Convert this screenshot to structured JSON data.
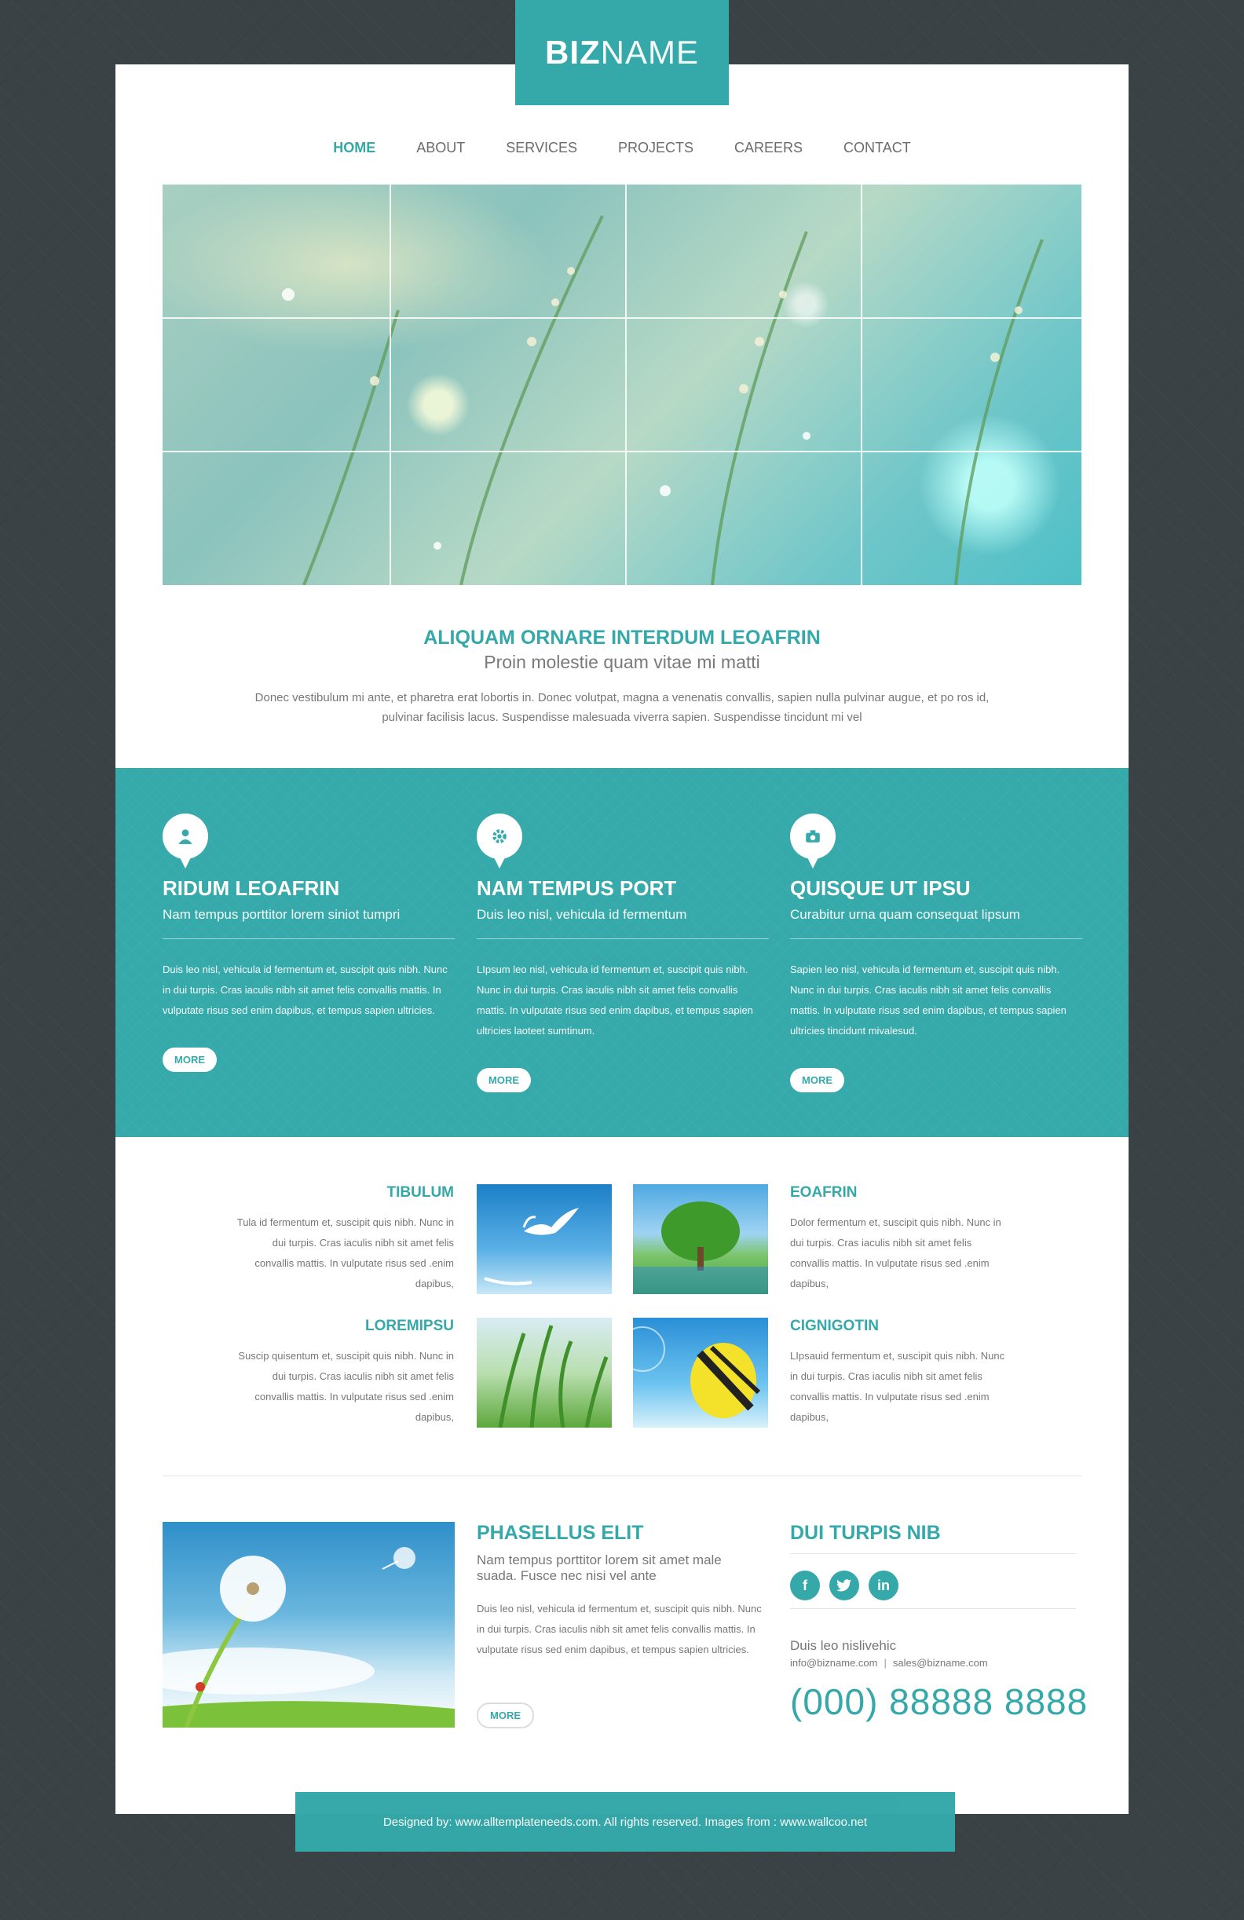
{
  "brand": {
    "bold": "BIZ",
    "light": "NAME"
  },
  "nav": [
    {
      "label": "HOME",
      "active": true
    },
    {
      "label": "ABOUT"
    },
    {
      "label": "SERVICES"
    },
    {
      "label": "PROJECTS"
    },
    {
      "label": "CAREERS"
    },
    {
      "label": "CONTACT"
    }
  ],
  "intro": {
    "title": "ALIQUAM ORNARE INTERDUM LEOAFRIN",
    "subtitle": "Proin molestie quam vitae mi matti",
    "text": "Donec vestibulum mi ante, et pharetra erat lobortis in. Donec volutpat, magna a venenatis convallis, sapien nulla pulvinar augue, et po ros id, pulvinar facilisis lacus. Suspendisse malesuada viverra sapien. Suspendisse tincidunt mi vel"
  },
  "features": [
    {
      "icon": "user-icon",
      "title": "RIDUM LEOAFRIN",
      "subtitle": "Nam tempus porttitor lorem siniot tumpri",
      "text": "Duis leo nisl, vehicula id fermentum et, suscipit quis nibh. Nunc in dui turpis. Cras iaculis nibh sit amet felis convallis mattis. In vulputate risus sed enim dapibus, et tempus sapien ultricies.",
      "more": "MORE"
    },
    {
      "icon": "gear-icon",
      "title": "NAM TEMPUS PORT",
      "subtitle": "Duis leo nisl, vehicula id fermentum",
      "text": "LIpsum leo nisl, vehicula id fermentum et, suscipit quis nibh. Nunc in dui turpis. Cras iaculis nibh sit amet felis convallis mattis. In vulputate risus sed enim dapibus, et tempus sapien ultricies laoteet sumtinum.",
      "more": "MORE"
    },
    {
      "icon": "camera-icon",
      "title": "QUISQUE UT IPSU",
      "subtitle": "Curabitur urna quam consequat lipsum",
      "text": "Sapien leo nisl, vehicula id fermentum et, suscipit quis nibh. Nunc in dui turpis. Cras iaculis nibh sit amet felis convallis mattis. In vulputate risus sed enim dapibus, et tempus sapien ultricies tincidunt mivalesud.",
      "more": "MORE"
    }
  ],
  "gallery": [
    {
      "title": "TIBULUM",
      "text": "Tula id fermentum et, suscipit quis nibh. Nunc in dui turpis. Cras iaculis nibh sit amet felis convallis mattis. In vulputate risus sed .enim dapibus,"
    },
    {
      "title": "EOAFRIN",
      "text": "Dolor fermentum et, suscipit quis nibh. Nunc in dui turpis. Cras iaculis nibh sit amet felis convallis mattis. In vulputate risus sed .enim dapibus,"
    },
    {
      "title": "LOREMIPSU",
      "text": "Suscip quisentum et, suscipit quis nibh. Nunc in dui turpis. Cras iaculis nibh sit amet felis convallis mattis. In vulputate risus sed .enim dapibus,"
    },
    {
      "title": "CIGNIGOTIN",
      "text": "LIpsauid fermentum et, suscipit quis nibh. Nunc in dui turpis. Cras iaculis nibh sit amet felis convallis mattis. In vulputate risus sed .enim dapibus,"
    }
  ],
  "phasellus": {
    "title": "PHASELLUS ELIT",
    "subtitle": "Nam tempus porttitor lorem sit amet male suada. Fusce nec nisi vel ante",
    "text": "Duis leo nisl, vehicula id fermentum et, suscipit quis nibh. Nunc in dui turpis. Cras iaculis nibh sit amet felis convallis mattis. In vulputate risus sed enim dapibus, et tempus sapien ultricies.",
    "more": "MORE"
  },
  "contact": {
    "title": "DUI TURPIS NIB",
    "socials": [
      {
        "icon": "facebook-icon",
        "glyph": "f"
      },
      {
        "icon": "twitter-icon",
        "glyph": "t"
      },
      {
        "icon": "linkedin-icon",
        "glyph": "in"
      }
    ],
    "name": "Duis leo nislivehic",
    "email1": "info@bizname.com",
    "separator": "|",
    "email2": "sales@bizname.com",
    "phone": "(000) 88888 8888"
  },
  "footer": {
    "text": "Designed by: www.alltemplateneeds.com. All rights reserved. Images from : www.wallcoo.net"
  },
  "colors": {
    "accent": "#35a8a9",
    "background": "#3b4245"
  }
}
